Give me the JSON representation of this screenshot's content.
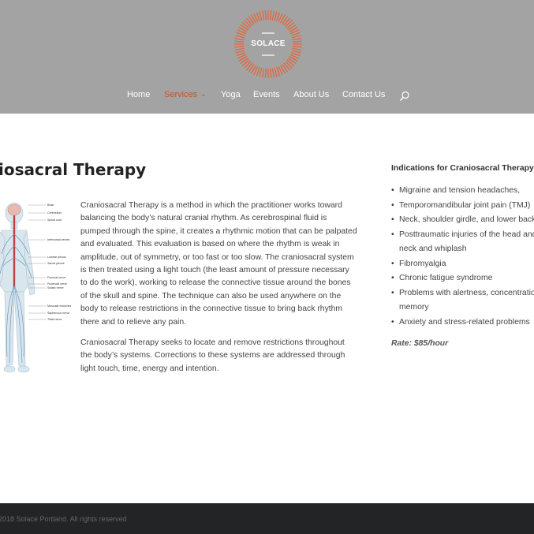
{
  "brand": {
    "logo_text": "SOLACE",
    "accent": "#e0693f",
    "header_bg": "#a3a3a3"
  },
  "nav": {
    "items": [
      {
        "label": "Home"
      },
      {
        "label": "Services",
        "active": true,
        "has_dropdown": true
      },
      {
        "label": "Yoga"
      },
      {
        "label": "Events"
      },
      {
        "label": "About Us"
      },
      {
        "label": "Contact Us"
      }
    ],
    "search_icon": "search-icon"
  },
  "main": {
    "title": "iosacral Therapy",
    "paragraph1": "Craniosacral Therapy is a method in which the practitioner works toward balancing the body’s natural cranial rhythm. As cerebrospinal fluid is pumped through the spine, it creates a rhythmic motion that can be palpated and evaluated. This evaluation is based on where the rhythm is weak in amplitude, out of symmetry, or too fast or too slow. The craniosacral system is then treated using a light touch (the least amount of pressure necessary to do the work), working to release the connective tissue around the bones of the skull and spine. The technique can also be used anywhere on the body to release restrictions in the connective tissue to bring back rhythm there and to relieve any pain.",
    "paragraph2": "Craniosacral Therapy seeks to locate and remove restrictions throughout the body’s systems. Corrections to these systems are addressed through light touch, time, energy and intention.",
    "figure_labels": [
      "Brain",
      "Cerebellum",
      "Spinal cord",
      "Intercostal nerves",
      "Lumbar plexus",
      "Sacral plexus",
      "Femoral nerve",
      "Pudendal nerve",
      "Sciatic nerve",
      "Muscular branches of femoral nerve",
      "Saphenous nerve",
      "Tibial nerve"
    ]
  },
  "sidebar": {
    "title": "Indications for Craniosacral Therapy",
    "items": [
      {
        "line1": "Migraine and tension headaches,"
      },
      {
        "line1": "Temporomandibular joint pain (TMJ)"
      },
      {
        "line1": "Neck, shoulder girdle, and lower back"
      },
      {
        "line1": "Posttraumatic injuries of the head and",
        "line2": "neck and whiplash"
      },
      {
        "line1": "Fibromyalgia"
      },
      {
        "line1": "Chronic fatigue syndrome"
      },
      {
        "line1": "Problems with alertness, concentration,",
        "line2": "memory"
      },
      {
        "line1": "Anxiety and stress-related problems"
      }
    ],
    "rate": "Rate: $85/hour"
  },
  "footer": {
    "text": "2018 Solace Portland. All rights reserved"
  }
}
